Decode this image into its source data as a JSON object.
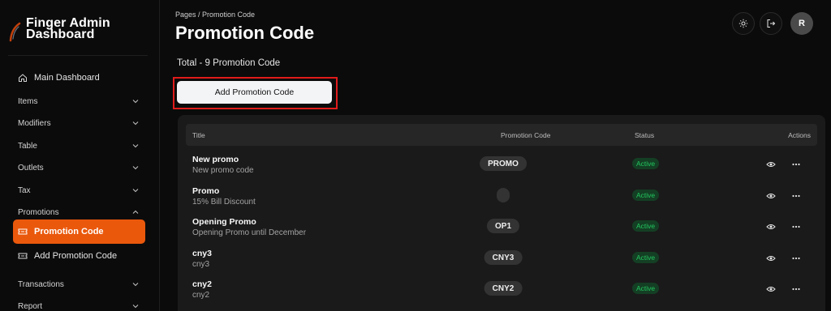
{
  "brand": {
    "name": "Finger Admin Dashboard"
  },
  "sidebar": {
    "items": [
      {
        "label": "Main Dashboard",
        "icon": "home-icon"
      },
      {
        "label": "Items",
        "icon": "chevron-down-icon"
      },
      {
        "label": "Modifiers",
        "icon": "chevron-down-icon"
      },
      {
        "label": "Table",
        "icon": "chevron-down-icon"
      },
      {
        "label": "Outlets",
        "icon": "chevron-down-icon"
      },
      {
        "label": "Tax",
        "icon": "chevron-down-icon"
      },
      {
        "label": "Promotions",
        "icon": "chevron-up-icon"
      },
      {
        "label": "Promotion Code",
        "icon": "ticket-icon"
      },
      {
        "label": "Add Promotion Code",
        "icon": "ticket-icon"
      },
      {
        "label": "Transactions",
        "icon": "chevron-down-icon"
      },
      {
        "label": "Report",
        "icon": "chevron-down-icon"
      }
    ],
    "accent": "#ea580c"
  },
  "header": {
    "breadcrumb": "Pages  /  Promotion Code",
    "title": "Promotion Code",
    "avatar_initial": "R"
  },
  "main": {
    "total": "Total - 9 Promotion Code",
    "add_button": "Add Promotion Code",
    "table": {
      "columns": [
        "Title",
        "Promotion Code",
        "Status",
        "Actions"
      ],
      "rows": [
        {
          "title": "New promo",
          "description": "New promo code",
          "code": "PROMO",
          "status": "Active"
        },
        {
          "title": "Promo",
          "description": "15% Bill Discount",
          "code": "",
          "status": "Active"
        },
        {
          "title": "Opening Promo",
          "description": "Opening Promo until December",
          "code": "OP1",
          "status": "Active"
        },
        {
          "title": "cny3",
          "description": "cny3",
          "code": "CNY3",
          "status": "Active"
        },
        {
          "title": "cny2",
          "description": "cny2",
          "code": "CNY2",
          "status": "Active"
        }
      ]
    }
  }
}
